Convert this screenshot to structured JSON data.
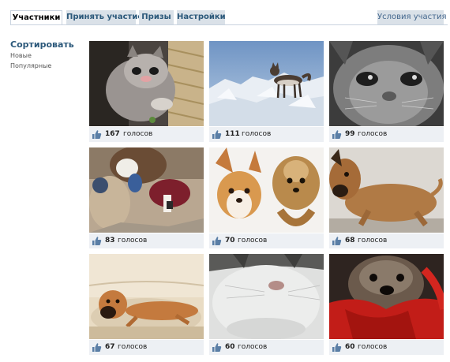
{
  "tabs": {
    "participants": "Участники",
    "participate": "Принять участие",
    "prizes": "Призы",
    "settings": "Настройки",
    "conditions": "Условия участия"
  },
  "sidebar": {
    "title": "Сортировать",
    "new": "Новые",
    "popular": "Популярные"
  },
  "vote_word": "голосов",
  "colors": {
    "link": "#2b587a",
    "tab_bg": "#dae1e8",
    "vote_bar": "#edf0f4",
    "like_icon": "#5b7fa6"
  },
  "entries": [
    {
      "votes": "167",
      "subject": "grey-kitten"
    },
    {
      "votes": "111",
      "subject": "husky-on-snow"
    },
    {
      "votes": "99",
      "subject": "grey-cat-closeup"
    },
    {
      "votes": "83",
      "subject": "child-with-dog"
    },
    {
      "votes": "70",
      "subject": "chihuahua-and-yorkie"
    },
    {
      "votes": "68",
      "subject": "brown-dog"
    },
    {
      "votes": "67",
      "subject": "boxer-on-sofa"
    },
    {
      "votes": "60",
      "subject": "white-cat"
    },
    {
      "votes": "60",
      "subject": "dog-in-red-scarf"
    }
  ]
}
